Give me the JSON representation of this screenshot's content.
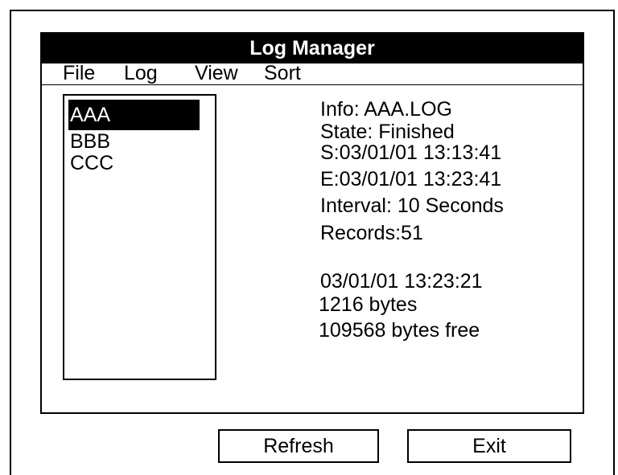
{
  "window": {
    "title": "Log Manager"
  },
  "menu": {
    "items": [
      {
        "label": "File"
      },
      {
        "label": "Log"
      },
      {
        "label": "View"
      },
      {
        "label": "Sort"
      }
    ]
  },
  "log_list": {
    "items": [
      {
        "label": "AAA",
        "selected": true
      },
      {
        "label": "BBB",
        "selected": false
      },
      {
        "label": "CCC",
        "selected": false
      }
    ]
  },
  "info": {
    "name": "Info: AAA.LOG",
    "state": "State: Finished",
    "start": "S:03/01/01 13:13:41",
    "end": "E:03/01/01 13:23:41",
    "interval": "Interval: 10 Seconds",
    "records": "Records:51",
    "timestamp": "03/01/01 13:23:21",
    "size": "1216 bytes",
    "free": "109568 bytes free"
  },
  "buttons": {
    "refresh": "Refresh",
    "exit": "Exit"
  }
}
